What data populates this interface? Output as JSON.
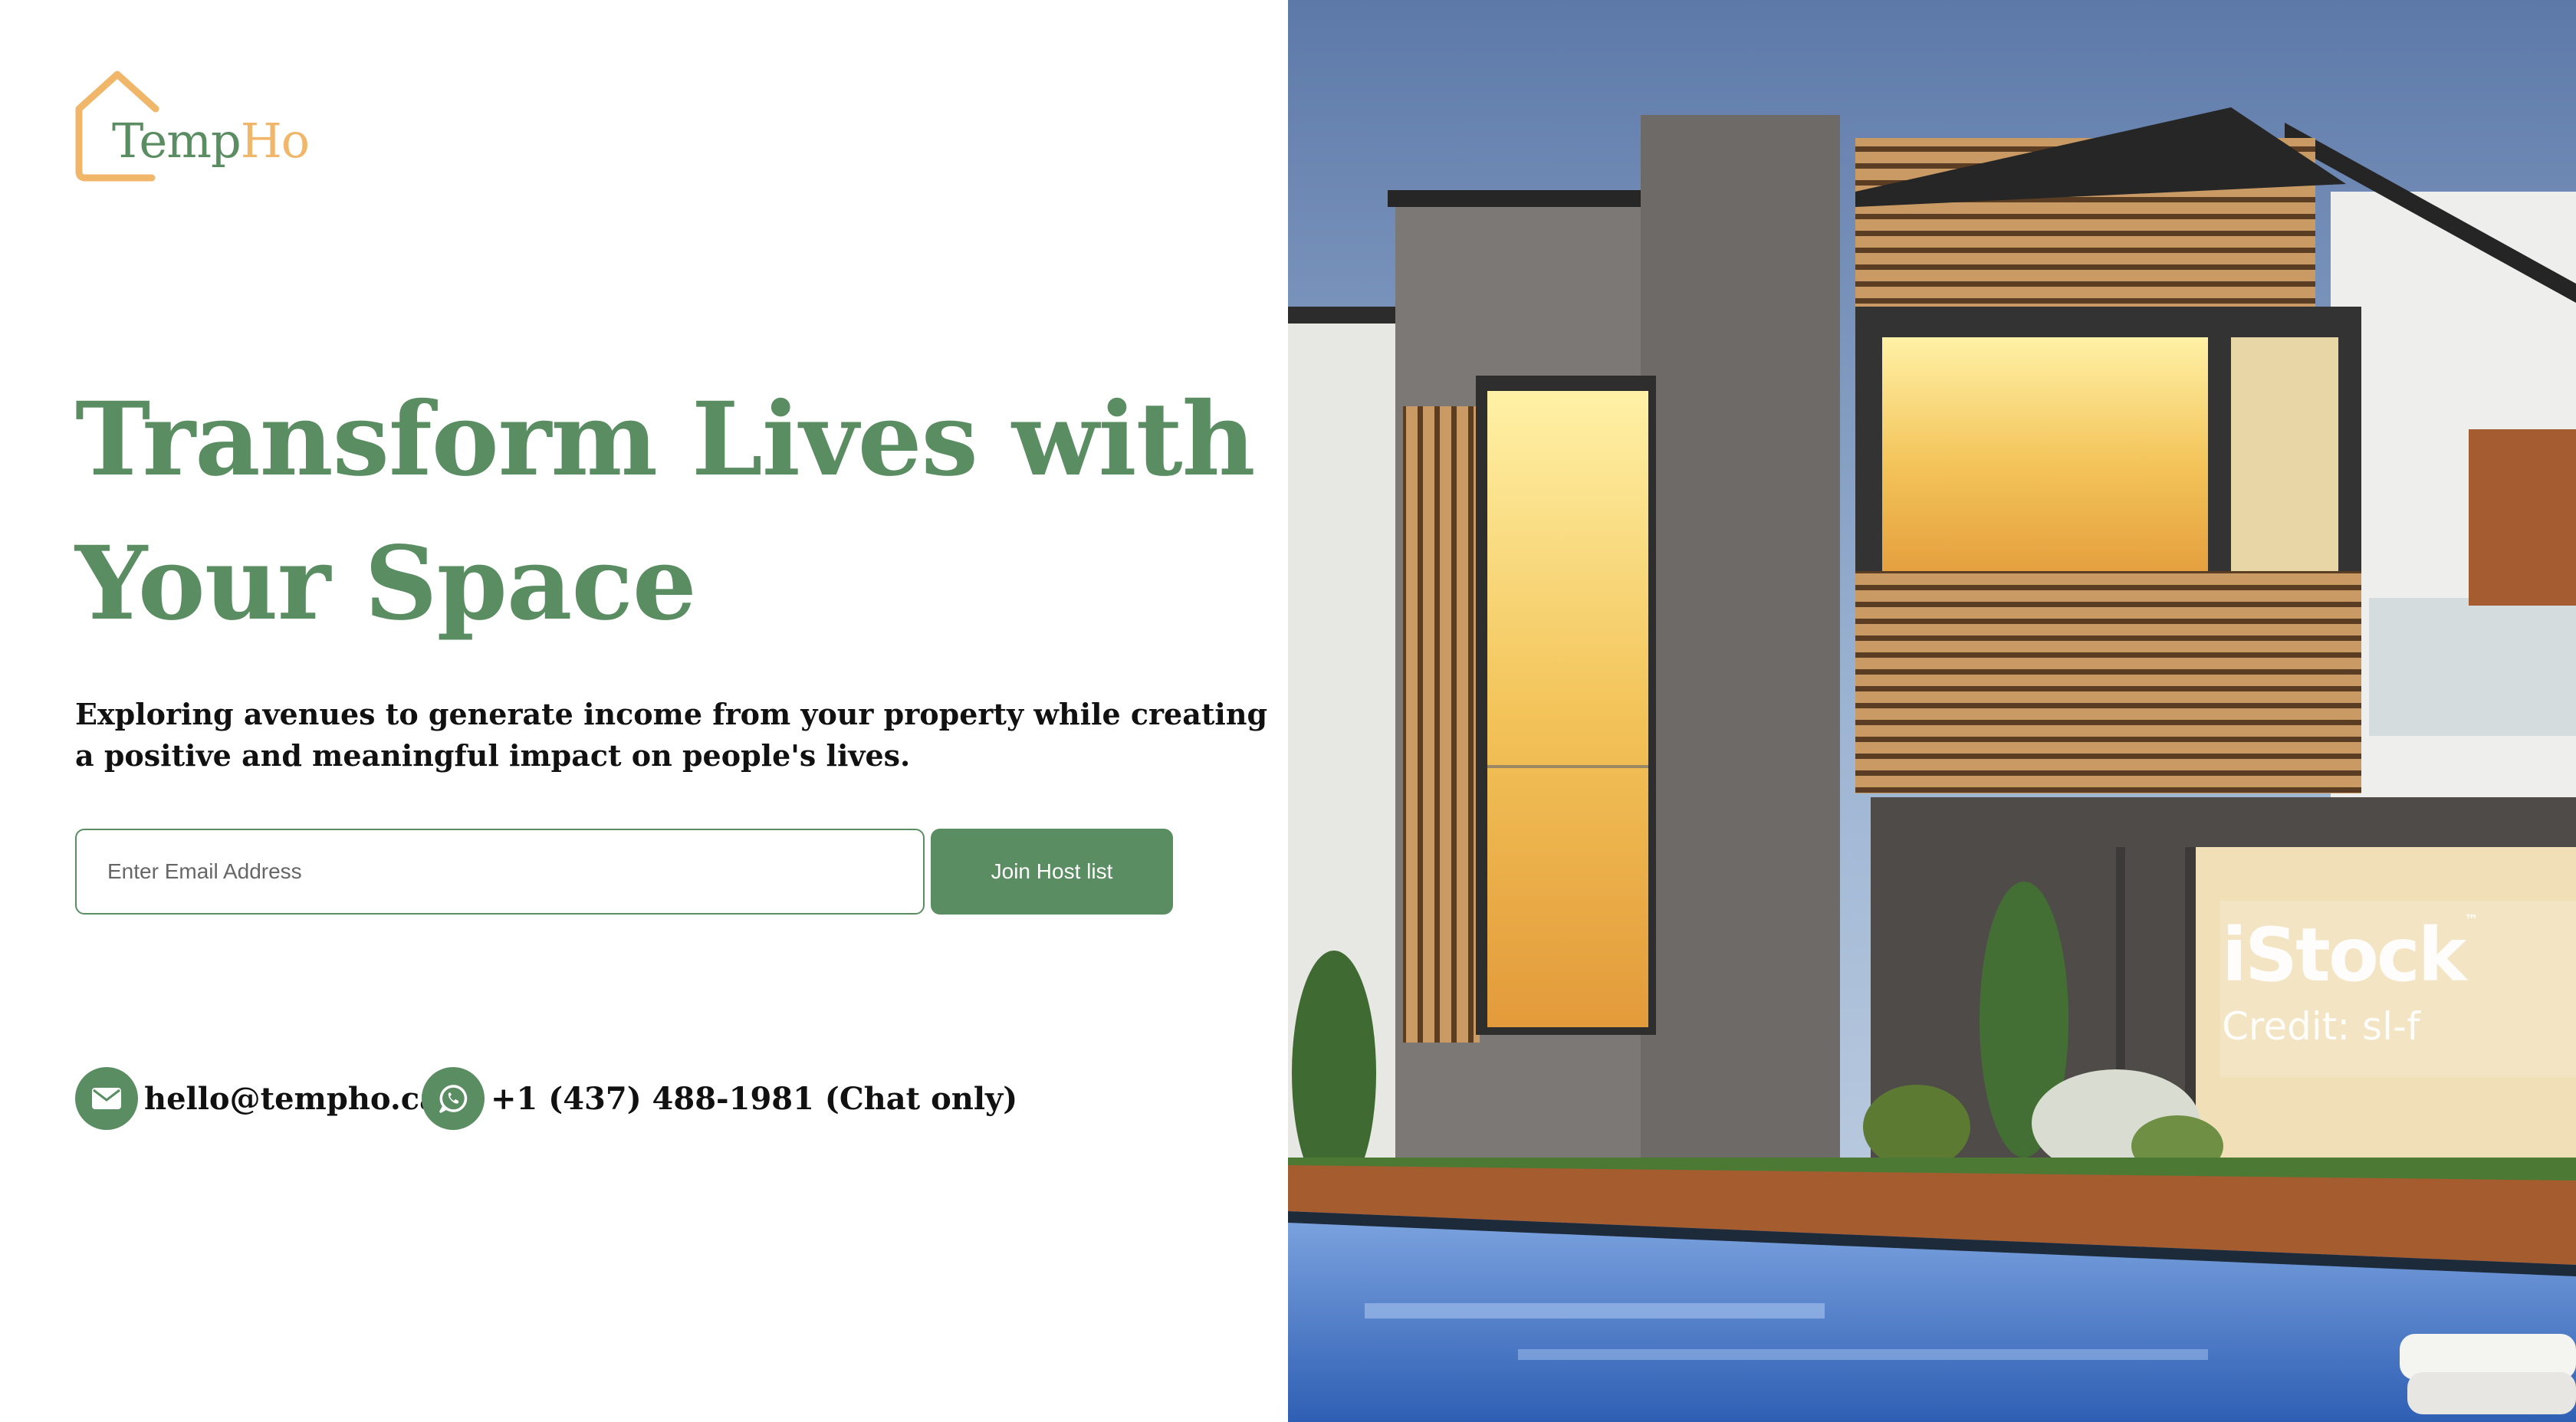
{
  "brand": {
    "name_main": "Temp",
    "name_accent": "Ho",
    "house_color": "#f0b66a",
    "text_color": "#5a8d62"
  },
  "hero": {
    "headline_line1": "Transform Lives with",
    "headline_line2": "Your Space",
    "subtitle": "Exploring avenues to generate income from your property while creating a positive and meaningful impact on people's lives."
  },
  "signup": {
    "email_placeholder": "Enter Email Address",
    "email_value": "",
    "join_label": "Join Host list"
  },
  "contacts": {
    "email": "hello@tempho.ca",
    "email_icon": "envelope-icon",
    "phone": "+1 (437) 488-1981 (Chat only)",
    "phone_icon": "whatsapp-icon"
  },
  "photo": {
    "subject": "modern-house-with-pool",
    "watermark_brand": "iStock",
    "watermark_tm": "™",
    "watermark_credit": "Credit: sl-f"
  },
  "colors": {
    "accent": "#5a8d62",
    "background": "#ffffff",
    "text": "#111111"
  }
}
